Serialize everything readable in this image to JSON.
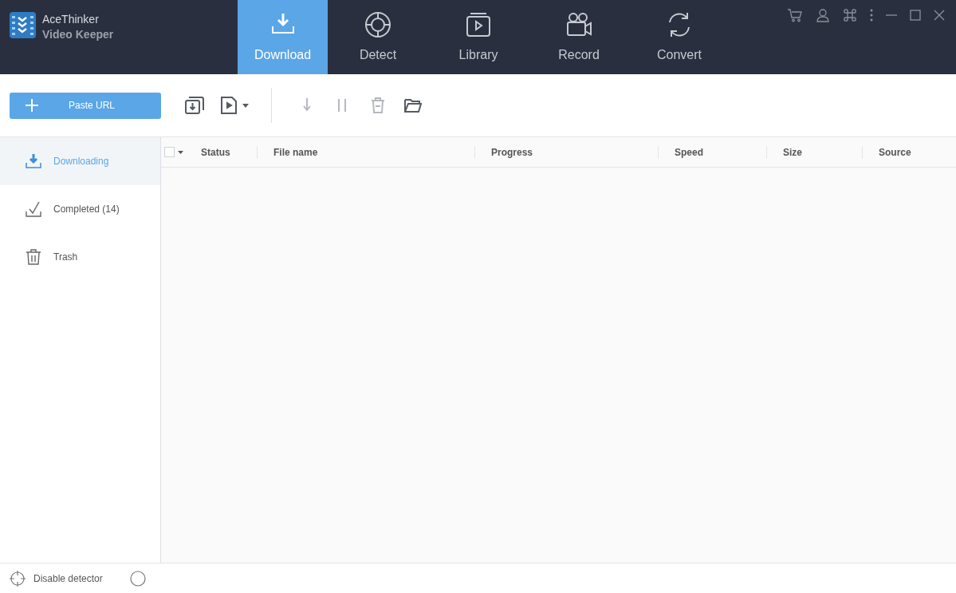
{
  "app": {
    "brand": "AceThinker",
    "product": "Video Keeper"
  },
  "tabs": [
    {
      "label": "Download",
      "kind": "download",
      "selected": true
    },
    {
      "label": "Detect",
      "kind": "detect",
      "selected": false
    },
    {
      "label": "Library",
      "kind": "library",
      "selected": false
    },
    {
      "label": "Record",
      "kind": "record",
      "selected": false
    },
    {
      "label": "Convert",
      "kind": "convert",
      "selected": false
    }
  ],
  "toolbar": {
    "paste_button": "Paste URL",
    "actions": [
      {
        "kind": "download",
        "disabled": true
      },
      {
        "kind": "pause",
        "disabled": true
      },
      {
        "kind": "delete",
        "disabled": true
      },
      {
        "kind": "folder",
        "disabled": false
      }
    ]
  },
  "sidebar": {
    "items": [
      {
        "label": "Downloading",
        "kind": "download",
        "selected": true
      },
      {
        "label": "Completed (14)",
        "kind": "check",
        "selected": false
      },
      {
        "label": "Trash",
        "kind": "trash",
        "selected": false
      }
    ]
  },
  "table": {
    "select_all_checked": false,
    "columns": [
      "Status",
      "File name",
      "Progress",
      "Speed",
      "Size",
      "Source"
    ]
  },
  "status_bar": {
    "detector_label": "Disable detector"
  }
}
